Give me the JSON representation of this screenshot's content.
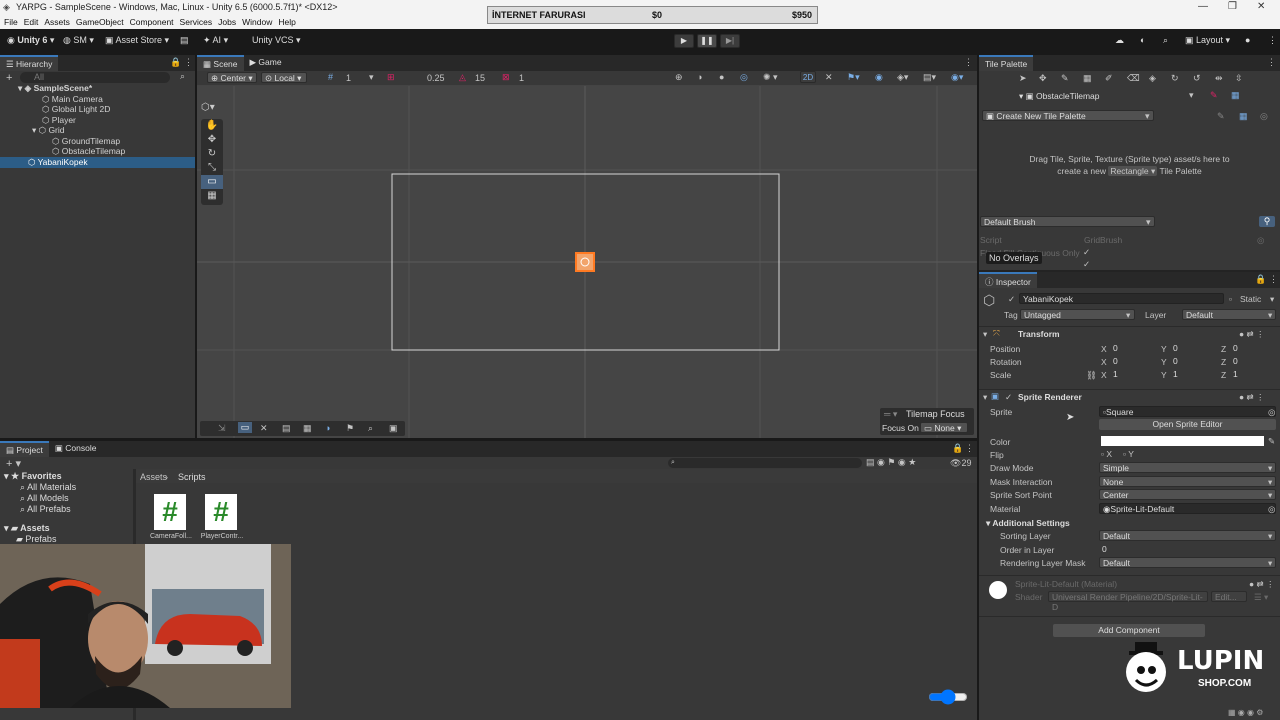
{
  "window": {
    "title": "YARPG - SampleScene - Windows, Mac, Linux - Unity 6.5 (6000.5.7f1)* <DX12>"
  },
  "menu": [
    "File",
    "Edit",
    "Assets",
    "GameObject",
    "Component",
    "Services",
    "Jobs",
    "Window",
    "Help"
  ],
  "overlay": {
    "title": "İNTERNET FARURASI",
    "value1": "$0",
    "value2": "$950"
  },
  "toolbar": {
    "unity": "Unity 6",
    "account": "SM",
    "asset_store": "Asset Store",
    "ai": "AI",
    "vcs": "Unity VCS",
    "layout": "Layout"
  },
  "hierarchy": {
    "tab": "Hierarchy",
    "search_placeholder": "All",
    "items": [
      {
        "label": "SampleScene*"
      },
      {
        "label": "Main Camera"
      },
      {
        "label": "Global Light 2D"
      },
      {
        "label": "Player"
      },
      {
        "label": "Grid"
      },
      {
        "label": "GroundTilemap"
      },
      {
        "label": "ObstacleTilemap"
      },
      {
        "label": "YabaniKopek"
      }
    ]
  },
  "scene": {
    "tabs": [
      "Scene",
      "Game"
    ],
    "pivot": "Center",
    "space": "Local",
    "grid_count": "1",
    "snap_value": "0.25",
    "rotate_snap": "15",
    "scale_snap": "1",
    "mode_2d": "2D",
    "tilemap_focus": "Tilemap Focus",
    "focus_on_label": "Focus On",
    "focus_on_value": "None"
  },
  "project": {
    "tabs": [
      "Project",
      "Console"
    ],
    "favorites": "Favorites",
    "fav_items": [
      "All Materials",
      "All Models",
      "All Prefabs"
    ],
    "assets": "Assets",
    "asset_items": [
      "Prefabs"
    ],
    "breadcrumb": [
      "Assets",
      "Scripts"
    ],
    "count": "29",
    "files": [
      {
        "name": "CameraFoll...",
        "icon": "#"
      },
      {
        "name": "PlayerContr...",
        "icon": "#"
      }
    ]
  },
  "tile_palette": {
    "tab": "Tile Palette",
    "target": "ObstacleTilemap",
    "palette": "Create New Tile Palette",
    "drop_text1": "Drag Tile, Sprite, Texture (Sprite type) asset/s here to",
    "drop_text2a": "create a new",
    "drop_shape": "Rectangle",
    "drop_text2b": "Tile Palette",
    "brush": "Default Brush",
    "script_label": "Script",
    "script_value": "GridBrush",
    "no_overlays": "No Overlays",
    "partial_label": "Flood Fill Contiguous Only"
  },
  "inspector": {
    "tab": "Inspector",
    "object_name": "YabaniKopek",
    "static": "Static",
    "tag_label": "Tag",
    "tag": "Untagged",
    "layer_label": "Layer",
    "layer": "Default",
    "transform": {
      "title": "Transform",
      "rows": [
        {
          "label": "Position",
          "x": "0",
          "y": "0",
          "z": "0"
        },
        {
          "label": "Rotation",
          "x": "0",
          "y": "0",
          "z": "0"
        },
        {
          "label": "Scale",
          "x": "1",
          "y": "1",
          "z": "1"
        }
      ]
    },
    "sprite_renderer": {
      "title": "Sprite Renderer",
      "sprite_label": "Sprite",
      "sprite": "Square",
      "open_editor": "Open Sprite Editor",
      "color_label": "Color",
      "color": "#ffffff",
      "flip_label": "Flip",
      "flip_x": "X",
      "flip_y": "Y",
      "draw_mode_label": "Draw Mode",
      "draw_mode": "Simple",
      "mask_label": "Mask Interaction",
      "mask": "None",
      "sort_point_label": "Sprite Sort Point",
      "sort_point": "Center",
      "material_label": "Material",
      "material": "Sprite-Lit-Default",
      "additional": "Additional Settings",
      "sorting_layer_label": "Sorting Layer",
      "sorting_layer": "Default",
      "order_label": "Order in Layer",
      "order": "0",
      "rendering_mask_label": "Rendering Layer Mask",
      "rendering_mask": "Default"
    },
    "material_block": {
      "name": "Sprite-Lit-Default (Material)",
      "shader_label": "Shader",
      "shader": "Universal Render Pipeline/2D/Sprite-Lit-D",
      "edit": "Edit..."
    },
    "add_component": "Add Component"
  },
  "brand": {
    "line1": "LUPIN",
    "line2": "SHOP.COM"
  },
  "colors": {
    "accent": "#3a79bb",
    "selection": "#2c5d87",
    "panel": "#383838",
    "brand_red": "#e0242b"
  }
}
